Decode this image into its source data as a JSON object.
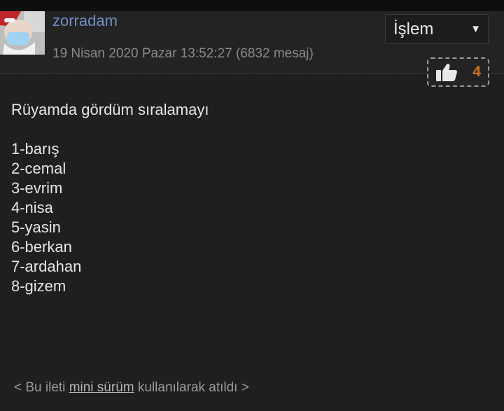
{
  "post": {
    "username": "zorradam",
    "timestamp": "19 Nisan 2020 Pazar 13:52:27 (6832 mesaj)",
    "action_label": "İşlem",
    "like_count": "4",
    "intro": "Rüyamda gördüm sıralamayı",
    "ranking": [
      "1-barış",
      "2-cemal",
      "3-evrim",
      "4-nisa",
      "5-yasin",
      "6-berkan",
      "7-ardahan",
      "8-gizem"
    ]
  },
  "footer": {
    "prefix": "< Bu ileti ",
    "link": "mini sürüm",
    "suffix": " kullanılarak atıldı >"
  },
  "icons": {
    "caret": "caret-down-icon",
    "like": "thumbs-up-icon"
  },
  "colors": {
    "background": "#1f1f1f",
    "username": "#6f8fc8",
    "like_count": "#d9721e"
  }
}
